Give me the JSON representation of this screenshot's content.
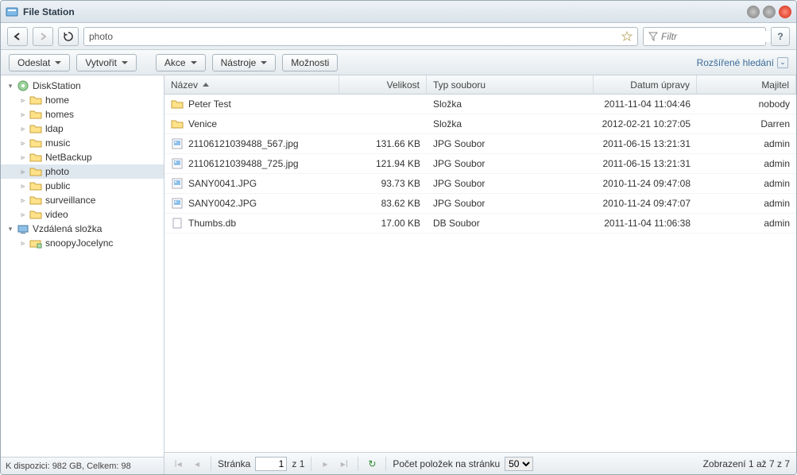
{
  "window": {
    "title": "File Station"
  },
  "nav": {
    "path_value": "photo",
    "filter_placeholder": "Filtr"
  },
  "toolbar": {
    "upload": "Odeslat",
    "create": "Vytvořit",
    "action": "Akce",
    "tools": "Nástroje",
    "options": "Možnosti",
    "adv_search": "Rozšířené hledání"
  },
  "tree": {
    "root1": "DiskStation",
    "items1": [
      "home",
      "homes",
      "ldap",
      "music",
      "NetBackup",
      "photo",
      "public",
      "surveillance",
      "video"
    ],
    "selected": "photo",
    "root2": "Vzdálená složka",
    "items2": [
      "snoopyJocelync"
    ],
    "status": "K dispozici: 982 GB, Celkem: 98"
  },
  "columns": {
    "name": "Název",
    "size": "Velikost",
    "type": "Typ souboru",
    "date": "Datum úpravy",
    "owner": "Majitel"
  },
  "rows": [
    {
      "icon": "folder",
      "name": "Peter Test",
      "size": "",
      "type": "Složka",
      "date": "2011-11-04 11:04:46",
      "owner": "nobody"
    },
    {
      "icon": "folder",
      "name": "Venice",
      "size": "",
      "type": "Složka",
      "date": "2012-02-21 10:27:05",
      "owner": "Darren"
    },
    {
      "icon": "jpg",
      "name": "21106121039488_567.jpg",
      "size": "131.66 KB",
      "type": "JPG Soubor",
      "date": "2011-06-15 13:21:31",
      "owner": "admin"
    },
    {
      "icon": "jpg",
      "name": "21106121039488_725.jpg",
      "size": "121.94 KB",
      "type": "JPG Soubor",
      "date": "2011-06-15 13:21:31",
      "owner": "admin"
    },
    {
      "icon": "jpg",
      "name": "SANY0041.JPG",
      "size": "93.73 KB",
      "type": "JPG Soubor",
      "date": "2010-11-24 09:47:08",
      "owner": "admin"
    },
    {
      "icon": "jpg",
      "name": "SANY0042.JPG",
      "size": "83.62 KB",
      "type": "JPG Soubor",
      "date": "2010-11-24 09:47:07",
      "owner": "admin"
    },
    {
      "icon": "file",
      "name": "Thumbs.db",
      "size": "17.00 KB",
      "type": "DB Soubor",
      "date": "2011-11-04 11:06:38",
      "owner": "admin"
    }
  ],
  "pager": {
    "page_label": "Stránka",
    "page_value": "1",
    "of_label": "z 1",
    "perpage_label": "Počet položek na stránku",
    "perpage_value": "50",
    "summary": "Zobrazení 1 až 7 z 7"
  }
}
